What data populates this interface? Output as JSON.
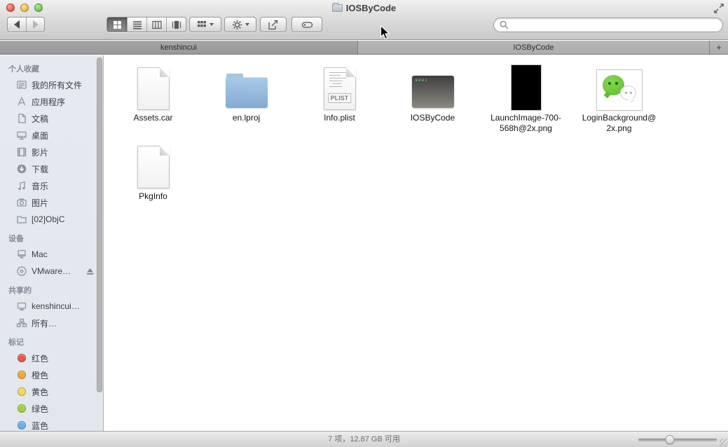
{
  "window_title": "IOSByCode",
  "window_proxy_icon": "folder-icon",
  "toolbar": {
    "back_icon": "chevron-left",
    "forward_icon": "chevron-right",
    "view_modes": [
      "icon-view",
      "list-view",
      "column-view",
      "coverflow-view"
    ],
    "selected_view": "icon-view",
    "buttons": [
      "arrange",
      "action-gear",
      "share",
      "tags"
    ],
    "search": {
      "icon": "magnifier",
      "value": ""
    }
  },
  "tabs": [
    {
      "label": "kenshincui",
      "active": false
    },
    {
      "label": "IOSByCode",
      "active": true
    }
  ],
  "new_tab_button": "+",
  "sidebar": {
    "sections": [
      {
        "title": "个人收藏",
        "items": [
          {
            "id": "all-my-files",
            "label": "我的所有文件",
            "icon": "all-my-files-icon"
          },
          {
            "id": "applications",
            "label": "应用程序",
            "icon": "applications-icon"
          },
          {
            "id": "documents",
            "label": "文稿",
            "icon": "documents-icon"
          },
          {
            "id": "desktop",
            "label": "桌面",
            "icon": "desktop-icon"
          },
          {
            "id": "movies",
            "label": "影片",
            "icon": "movies-icon"
          },
          {
            "id": "downloads",
            "label": "下载",
            "icon": "downloads-icon"
          },
          {
            "id": "music",
            "label": "音乐",
            "icon": "music-icon"
          },
          {
            "id": "pictures",
            "label": "图片",
            "icon": "pictures-icon"
          },
          {
            "id": "02objc",
            "label": "[02]ObjC",
            "icon": "folder-icon"
          }
        ]
      },
      {
        "title": "设备",
        "items": [
          {
            "id": "mac",
            "label": "Mac",
            "icon": "computer-icon"
          },
          {
            "id": "vmware",
            "label": "VMware…",
            "icon": "disc-icon",
            "eject": true
          }
        ]
      },
      {
        "title": "共享的",
        "items": [
          {
            "id": "kenshincui-shared",
            "label": "kenshincui…",
            "icon": "shared-computer-icon"
          },
          {
            "id": "all-shared",
            "label": "所有…",
            "icon": "network-icon"
          }
        ]
      },
      {
        "title": "标记",
        "items": [
          {
            "id": "tag-red",
            "label": "红色",
            "icon": "tag-dot",
            "color": "#e25a52"
          },
          {
            "id": "tag-orange",
            "label": "橙色",
            "icon": "tag-dot",
            "color": "#f3a63c"
          },
          {
            "id": "tag-yellow",
            "label": "黄色",
            "icon": "tag-dot",
            "color": "#f2da50"
          },
          {
            "id": "tag-green",
            "label": "绿色",
            "icon": "tag-dot",
            "color": "#a3d238"
          },
          {
            "id": "tag-blue",
            "label": "蓝色",
            "icon": "tag-dot",
            "color": "#67b1ee"
          }
        ]
      }
    ]
  },
  "files": [
    {
      "name": "Assets.car",
      "kind": "file",
      "display_lines": [
        "Assets.car"
      ]
    },
    {
      "name": "en.lproj",
      "kind": "folder",
      "display_lines": [
        "en.lproj"
      ]
    },
    {
      "name": "Info.plist",
      "kind": "plist",
      "plist_badge": "PLIST",
      "display_lines": [
        "Info.plist"
      ]
    },
    {
      "name": "IOSByCode",
      "kind": "executable",
      "exec_text": "exec",
      "display_lines": [
        "IOSByCode"
      ]
    },
    {
      "name": "LaunchImage-700-568h@2x.png",
      "kind": "image-black",
      "display_lines": [
        "LaunchImage-700-",
        "568h@2x.png"
      ]
    },
    {
      "name": "LoginBackground@2x.png",
      "kind": "image-wechat",
      "display_lines": [
        "LoginBackground@",
        "2x.png"
      ]
    },
    {
      "name": "PkgInfo",
      "kind": "file",
      "display_lines": [
        "PkgInfo"
      ]
    }
  ],
  "statusbar": {
    "text": "7 项，12.87 GB 可用",
    "size_slider_percent": 40
  },
  "accent_colors": {
    "folder_blue": "#93b9dd",
    "wechat_green": "#5fbe31",
    "sidebar_bg": "#e4e9ef"
  }
}
